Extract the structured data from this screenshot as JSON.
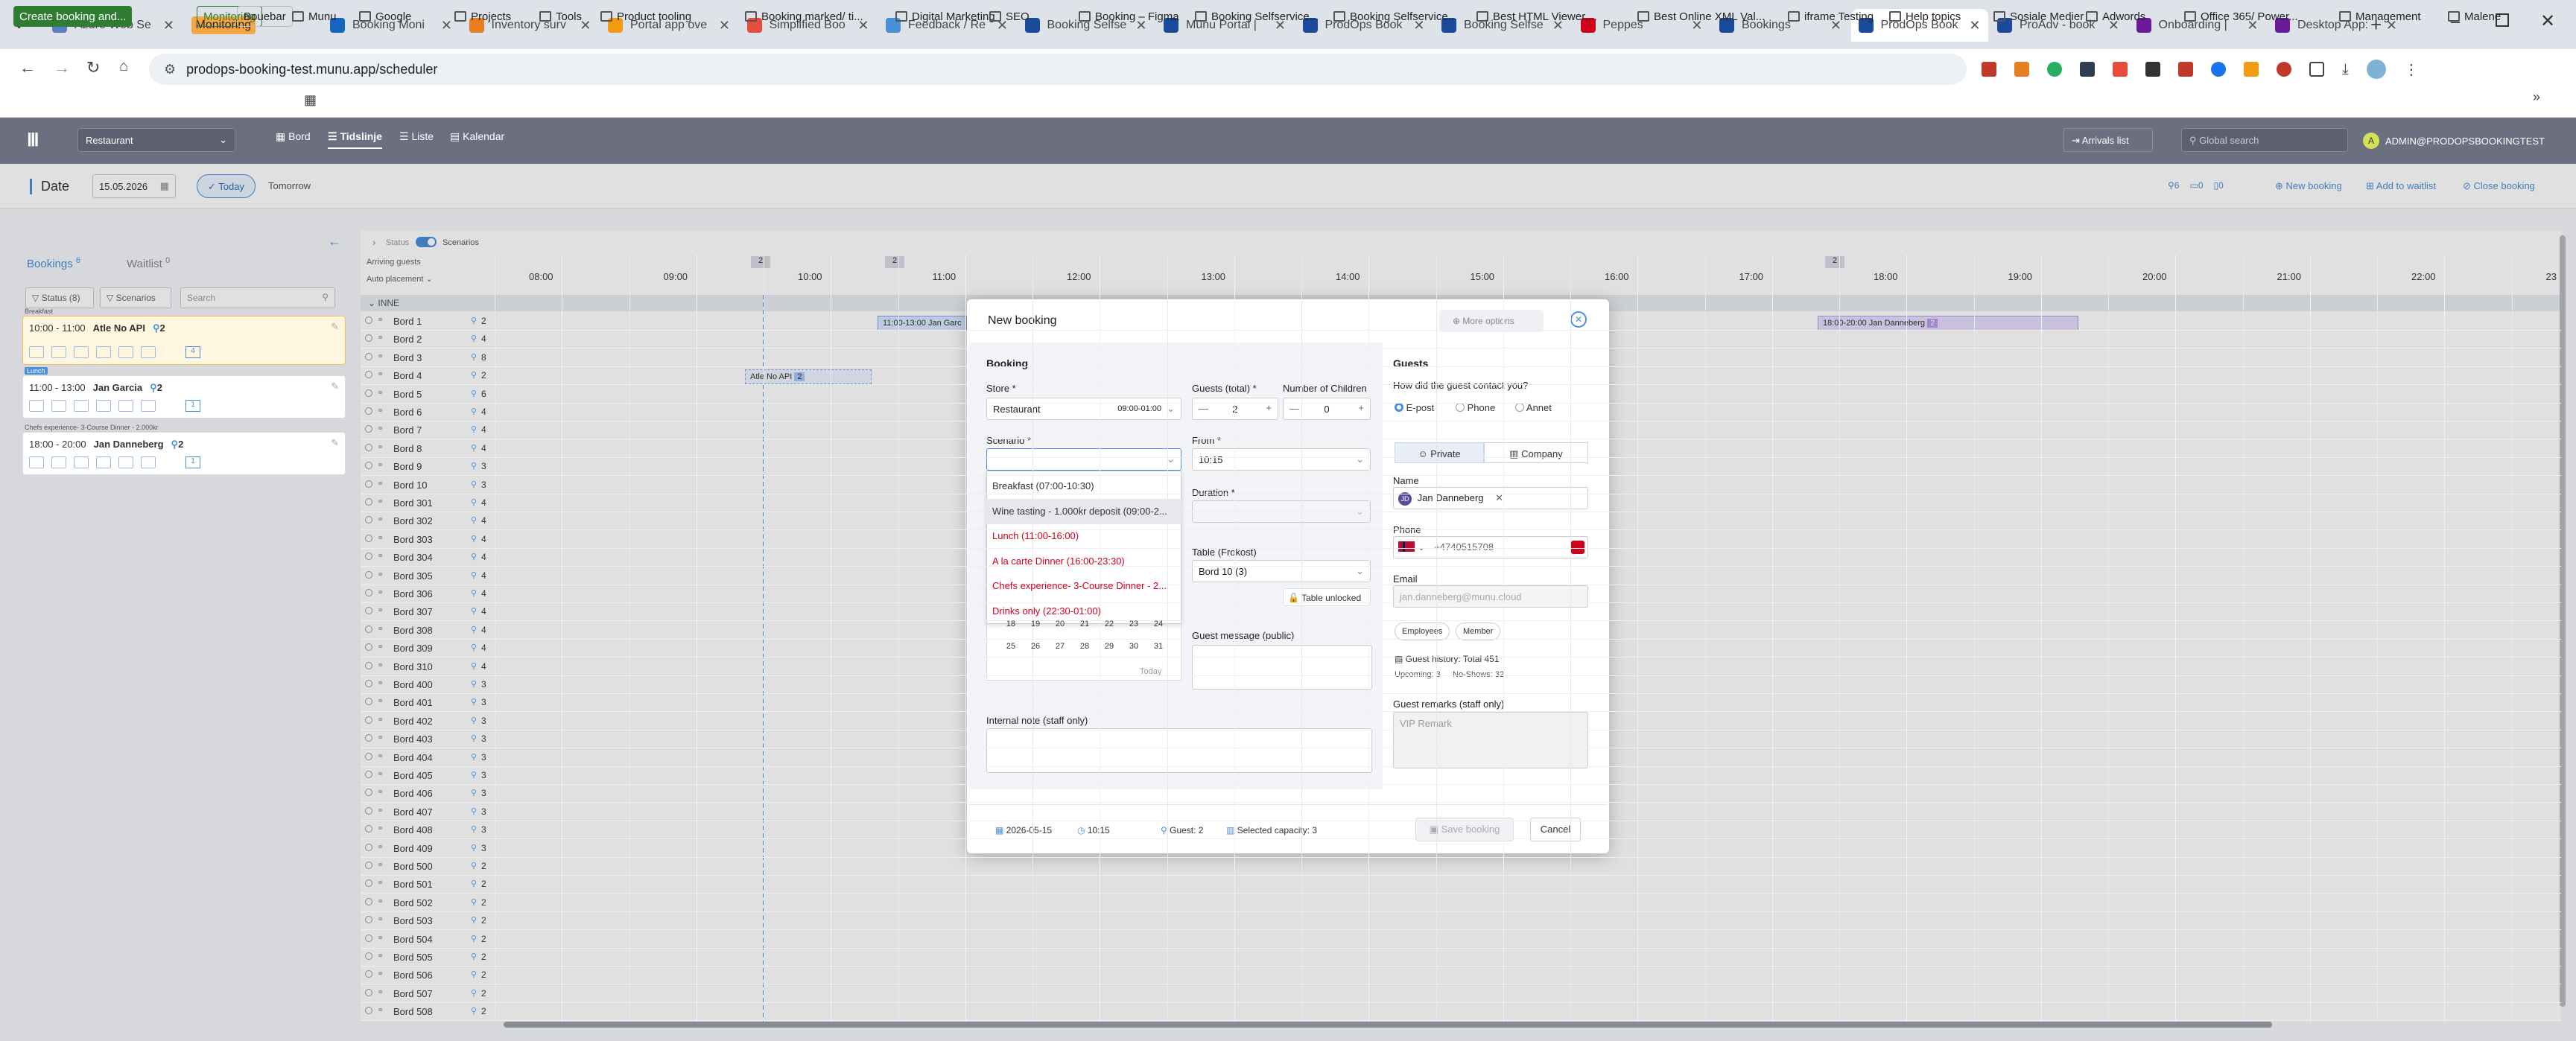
{
  "browser": {
    "tabs": [
      {
        "label": "Azure Web Se"
      },
      {
        "label": "Monitoring"
      },
      {
        "label": "Booking Moni"
      },
      {
        "label": "Inventory surv"
      },
      {
        "label": "Portal app ove"
      },
      {
        "label": "Simplified Boo"
      },
      {
        "label": "Feedback / Re"
      },
      {
        "label": "Booking Selfse"
      },
      {
        "label": "Munu Portal |"
      },
      {
        "label": "ProdOps Book"
      },
      {
        "label": "Booking Selfse"
      },
      {
        "label": "Peppes"
      },
      {
        "label": "Bookings"
      },
      {
        "label": "ProdOps Book"
      },
      {
        "label": "ProAdv - book"
      },
      {
        "label": "Onboarding |"
      },
      {
        "label": "Desktop App:"
      }
    ],
    "url": "prodops-booking-test.munu.app/scheduler",
    "bookmarks": [
      "Create booking and...",
      "Monitoring",
      "Bouebar",
      "Munu",
      "Google",
      "Projects",
      "Tools",
      "Product tooling",
      "Booking marked/ ti...",
      "Digital Marketing",
      "SEO",
      "Booking – Figma",
      "Booking Selfservice...",
      "Booking Selfservice...",
      "Best HTML Viewer,...",
      "Best Online XML Val...",
      "iframe Testing",
      "Help topics",
      "Sosiale Medier",
      "Adwords",
      "Office 365/ Power...",
      "Management",
      "Malene"
    ]
  },
  "app": {
    "store_select": "Restaurant",
    "nav": [
      "Bord",
      "Tidslinje",
      "Liste",
      "Kalendar"
    ],
    "arrivals": "Arrivals list",
    "search_placeholder": "Global search",
    "user": "ADMIN@PRODOPSBOOKINGTEST",
    "user_initial": "A"
  },
  "subheader": {
    "date_label": "Date",
    "date_value": "15.05.2026",
    "today": "Today",
    "tomorrow": "Tomorrow",
    "count_a": "6",
    "count_b": "0",
    "count_c": "0",
    "new_booking": "New booking",
    "add_waitlist": "Add to waitlist",
    "close_booking": "Close booking"
  },
  "left": {
    "bookings_tab": "Bookings",
    "bookings_count": "6",
    "waitlist_tab": "Waitlist",
    "waitlist_count": "0",
    "status_filter": "Status (8)",
    "scenarios_filter": "Scenarios",
    "search_placeholder": "Search",
    "cards": [
      {
        "tag": "Breakfast",
        "time": "10:00 - 11:00",
        "name": "Atle No API",
        "guests": "2",
        "table": "4"
      },
      {
        "tag": "Lunch",
        "time": "11:00 - 13:00",
        "name": "Jan Garcia",
        "guests": "2",
        "table": "1"
      },
      {
        "tag": "Chefs experience- 3-Course Dinner - 2.000kr",
        "time": "18:00 - 20:00",
        "name": "Jan Danneberg",
        "guests": "2",
        "table": "1"
      }
    ]
  },
  "timeline": {
    "status_toggle": "Status",
    "scenarios_toggle": "Scenarios",
    "arriving_guests": "Arriving guests",
    "auto_placement": "Auto placement",
    "area": "INNE",
    "hours": [
      "08:00",
      "09:00",
      "10:00",
      "11:00",
      "12:00",
      "13:00",
      "14:00",
      "15:00",
      "16:00",
      "17:00",
      "18:00",
      "19:00",
      "20:00",
      "21:00",
      "22:00",
      "23"
    ],
    "arrival_counts": [
      "2",
      "2",
      "2"
    ],
    "tables": [
      {
        "name": "Bord 1",
        "cap": "2"
      },
      {
        "name": "Bord 2",
        "cap": "4"
      },
      {
        "name": "Bord 3",
        "cap": "8"
      },
      {
        "name": "Bord 4",
        "cap": "2"
      },
      {
        "name": "Bord 5",
        "cap": "6"
      },
      {
        "name": "Bord 6",
        "cap": "4"
      },
      {
        "name": "Bord 7",
        "cap": "4"
      },
      {
        "name": "Bord 8",
        "cap": "4"
      },
      {
        "name": "Bord 9",
        "cap": "3"
      },
      {
        "name": "Bord 10",
        "cap": "3"
      },
      {
        "name": "Bord 301",
        "cap": "4"
      },
      {
        "name": "Bord 302",
        "cap": "4"
      },
      {
        "name": "Bord 303",
        "cap": "4"
      },
      {
        "name": "Bord 304",
        "cap": "4"
      },
      {
        "name": "Bord 305",
        "cap": "4"
      },
      {
        "name": "Bord 306",
        "cap": "4"
      },
      {
        "name": "Bord 307",
        "cap": "4"
      },
      {
        "name": "Bord 308",
        "cap": "4"
      },
      {
        "name": "Bord 309",
        "cap": "4"
      },
      {
        "name": "Bord 310",
        "cap": "4"
      },
      {
        "name": "Bord 400",
        "cap": "3"
      },
      {
        "name": "Bord 401",
        "cap": "3"
      },
      {
        "name": "Bord 402",
        "cap": "3"
      },
      {
        "name": "Bord 403",
        "cap": "3"
      },
      {
        "name": "Bord 404",
        "cap": "3"
      },
      {
        "name": "Bord 405",
        "cap": "3"
      },
      {
        "name": "Bord 406",
        "cap": "3"
      },
      {
        "name": "Bord 407",
        "cap": "3"
      },
      {
        "name": "Bord 408",
        "cap": "3"
      },
      {
        "name": "Bord 409",
        "cap": "3"
      },
      {
        "name": "Bord 500",
        "cap": "2"
      },
      {
        "name": "Bord 501",
        "cap": "2"
      },
      {
        "name": "Bord 502",
        "cap": "2"
      },
      {
        "name": "Bord 503",
        "cap": "2"
      },
      {
        "name": "Bord 504",
        "cap": "2"
      },
      {
        "name": "Bord 505",
        "cap": "2"
      },
      {
        "name": "Bord 506",
        "cap": "2"
      },
      {
        "name": "Bord 507",
        "cap": "2"
      },
      {
        "name": "Bord 508",
        "cap": "2"
      }
    ],
    "blocks": [
      {
        "label": "Atle No API",
        "badge": "2"
      },
      {
        "label": "11:00-13:00 Jan Garc",
        "badge": ""
      },
      {
        "label": "18:00-20:00 Jan Danneberg",
        "badge": "2"
      }
    ]
  },
  "modal": {
    "title": "New booking",
    "more_options": "More options",
    "booking_section": "Booking",
    "store_label": "Store *",
    "store_value": "Restaurant",
    "store_hours": "09:00-01:00",
    "guests_label": "Guests (total) *",
    "guests_value": "2",
    "children_label": "Number of Children",
    "children_value": "0",
    "scenario_label": "Scenario *",
    "scenario_options": [
      {
        "label": "Breakfast (07:00-10:30)",
        "state": "normal"
      },
      {
        "label": "Wine tasting - 1.000kr deposit (09:00-2...",
        "state": "hover"
      },
      {
        "label": "Lunch (11:00-16:00)",
        "state": "red"
      },
      {
        "label": "A la carte Dinner (16:00-23:30)",
        "state": "red"
      },
      {
        "label": "Chefs experience- 3-Course Dinner - 2...",
        "state": "red"
      },
      {
        "label": "Drinks only (22:30-01:00)",
        "state": "red"
      }
    ],
    "calendar_rows": [
      [
        "18",
        "19",
        "20",
        "21",
        "22",
        "23",
        "24"
      ],
      [
        "25",
        "26",
        "27",
        "28",
        "29",
        "30",
        "31"
      ]
    ],
    "calendar_today": "Today",
    "from_label": "From *",
    "from_value": "10:15",
    "duration_label": "Duration *",
    "table_label": "Table (Frokost)",
    "table_value": "Bord 10 (3)",
    "table_unlocked": "Table unlocked",
    "guest_message_label": "Guest message (public)",
    "internal_note_label": "Internal note (staff only)",
    "guests_section": "Guests",
    "contact_q": "How did the guest contact you?",
    "contact_options": [
      "E-post",
      "Phone",
      "Annet"
    ],
    "private_tab": "Private",
    "company_tab": "Company",
    "name_label": "Name",
    "name_value": "Jan Danneberg",
    "name_initials": "JD",
    "phone_label": "Phone",
    "phone_value": "+4740515708",
    "email_label": "Email",
    "email_value": "jan.danneberg@munu.cloud",
    "tag_employees": "Employees",
    "tag_member": "Member",
    "history": "Guest history: Total 451",
    "upcoming": "Upcoming: 3",
    "noshows": "No-Shows: 32",
    "remarks_label": "Guest remarks (staff only)",
    "remarks_placeholder": "VIP Remark",
    "footer_date": "2026-05-15",
    "footer_time": "10:15",
    "footer_guests": "Guest: 2",
    "footer_capacity": "Selected capacity: 3",
    "save": "Save booking",
    "cancel": "Cancel"
  },
  "colors": {
    "app_header": "#6b6f80",
    "accent": "#4a8fd9",
    "red": "#d0021b",
    "booking_card": "#fff6e0",
    "purple_block": "#e6dcfb"
  }
}
